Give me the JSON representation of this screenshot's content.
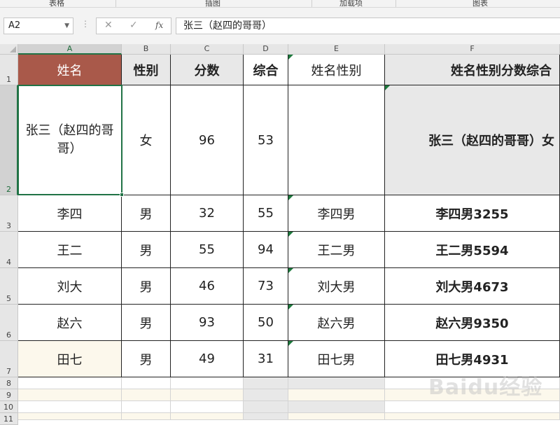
{
  "ribbon": {
    "groups": [
      "表格",
      "插图",
      "加载项",
      "图表"
    ]
  },
  "formula_bar": {
    "name_box": "A2",
    "cancel_icon": "✕",
    "confirm_icon": "✓",
    "fx_label": "fx",
    "content": "张三（赵四的哥哥）"
  },
  "sheet": {
    "columns": [
      "A",
      "B",
      "C",
      "D",
      "E",
      "F"
    ],
    "selected_column": "A",
    "rows": [
      "1",
      "2",
      "3",
      "4",
      "5",
      "6",
      "7",
      "8",
      "9",
      "10",
      "11"
    ],
    "selected_row": "2",
    "headers": [
      "姓名",
      "性别",
      "分数",
      "综合",
      "姓名性别",
      "姓名性别分数综合"
    ],
    "data": [
      [
        "张三（赵四的哥哥）",
        "女",
        "96",
        "53",
        "",
        "张三（赵四的哥哥）女"
      ],
      [
        "李四",
        "男",
        "32",
        "55",
        "李四男",
        "李四男3255"
      ],
      [
        "王二",
        "男",
        "55",
        "94",
        "王二男",
        "王二男5594"
      ],
      [
        "刘大",
        "男",
        "46",
        "73",
        "刘大男",
        "刘大男4673"
      ],
      [
        "赵六",
        "男",
        "93",
        "50",
        "赵六男",
        "赵六男9350"
      ],
      [
        "田七",
        "男",
        "49",
        "31",
        "田七男",
        "田七男4931"
      ]
    ],
    "active_cell": "A2"
  },
  "watermark": "Baidu经验",
  "colors": {
    "header_name_bg": "#a9594a",
    "selection": "#217346",
    "shade": "#e8e8e8",
    "cream": "#fcf8ec"
  }
}
